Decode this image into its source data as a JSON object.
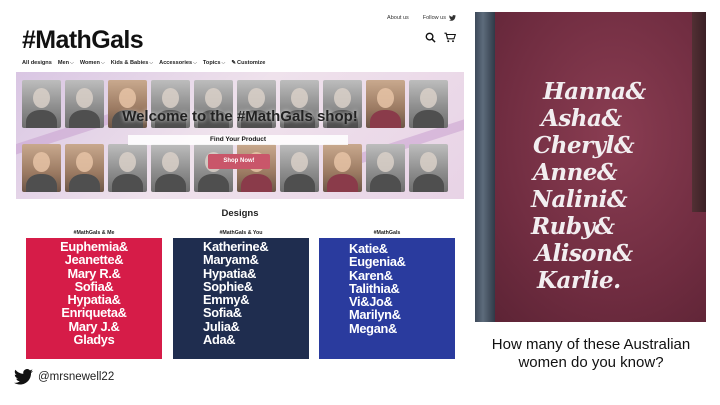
{
  "shop": {
    "top_links": {
      "about": "About us",
      "follow": "Follow us"
    },
    "logo": "#MathGals",
    "nav": [
      {
        "label": "All designs",
        "has_menu": false
      },
      {
        "label": "Men",
        "has_menu": true
      },
      {
        "label": "Women",
        "has_menu": true
      },
      {
        "label": "Kids & Babies",
        "has_menu": true
      },
      {
        "label": "Accessories",
        "has_menu": true
      },
      {
        "label": "Topics",
        "has_menu": true
      },
      {
        "label": "Customize",
        "has_menu": false
      }
    ],
    "banner": {
      "title": "Welcome to the #MathGals shop!",
      "find_label": "Find Your Product",
      "cta": "Shop Now!"
    },
    "designs_title": "Designs",
    "products": [
      {
        "title": "#MathGals & Me",
        "color": "#d61c48",
        "lines": [
          "Euphemia&",
          "Jeanette&",
          "Mary R.&",
          "Sofia&",
          "Hypatia&",
          "Enriqueta&",
          "Mary J.&",
          "Gladys"
        ]
      },
      {
        "title": "#MathGals & You",
        "color": "#1f2d4f",
        "lines": [
          "Katherine&",
          "Maryam&",
          "Hypatia&",
          "Sophie&",
          "Emmy&",
          "Sofia&",
          "Julia&",
          "Ada&"
        ]
      },
      {
        "title": "#MathGals",
        "color": "#2a3b9e",
        "lines": [
          "Katie&",
          "Eugenia&",
          "Karen&",
          "Talithia&",
          "Vi&Jo&",
          "Marilyn&",
          "Megan&"
        ]
      }
    ]
  },
  "tshirt_names": [
    "Hanna&",
    "Asha&",
    "Cheryl&",
    "Anne&",
    "Nalini&",
    "Ruby&",
    "Alison&",
    "Karlie."
  ],
  "caption": "How many of these Australian women do you know?",
  "handle": "@mrsnewell22",
  "colors": {
    "shop_now": "#c9566a",
    "twitter_icon": "#111111",
    "shirt_maroon": "#6f2c40"
  }
}
